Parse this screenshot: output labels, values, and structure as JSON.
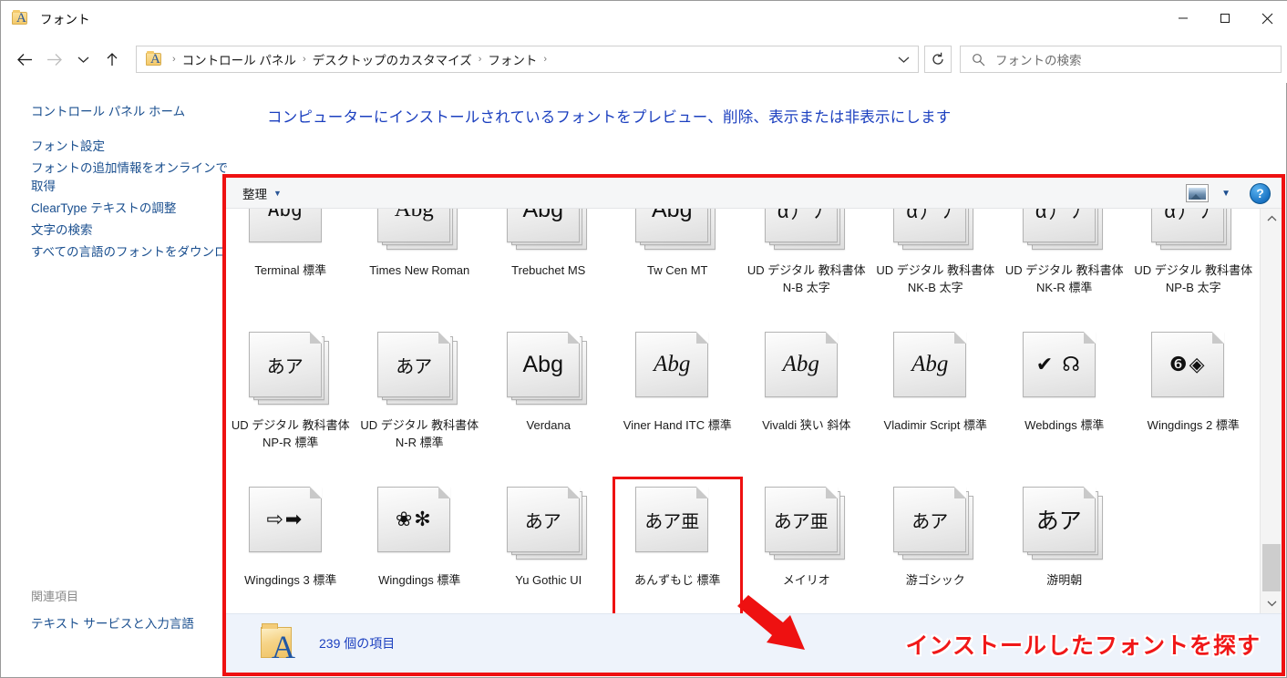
{
  "window": {
    "title": "フォント",
    "icon": "font-folder-icon",
    "minimize_label": "最小化",
    "maximize_label": "最大化",
    "close_label": "閉じる"
  },
  "addressbar": {
    "back_label": "戻る",
    "forward_label": "進む",
    "recent_label": "最近表示した場所",
    "up_label": "上へ",
    "refresh_label": "更新",
    "crumbs": [
      "コントロール パネル",
      "デスクトップのカスタマイズ",
      "フォント"
    ],
    "separator": "›",
    "dropdown_label": "▾"
  },
  "search": {
    "placeholder": "フォントの検索",
    "value": "",
    "icon": "search-icon"
  },
  "sidebar": {
    "items": [
      "コントロール パネル ホーム",
      "フォント設定",
      "フォントの追加情報をオンラインで取得",
      "ClearType テキストの調整",
      "文字の検索",
      "すべての言語のフォントをダウンロード"
    ],
    "related_title": "関連項目",
    "related_items": [
      "テキスト サービスと入力言語"
    ]
  },
  "main": {
    "heading": "コンピューターにインストールされているフォントをプレビュー、削除、表示または非表示にします"
  },
  "toolbar": {
    "organize_label": "整理",
    "organize_caret": "▼",
    "view_icon": "view-options-icon",
    "view_caret": "▼",
    "help_label": "?"
  },
  "grid": {
    "fonts": [
      {
        "name": "Terminal 標準",
        "glyph": "Abg",
        "style": "mono",
        "stack": false
      },
      {
        "name": "Times New Roman",
        "glyph": "Abg",
        "style": "serif",
        "stack": true
      },
      {
        "name": "Trebuchet MS",
        "glyph": "Abg",
        "style": "sans",
        "stack": true
      },
      {
        "name": "Tw Cen MT",
        "glyph": "Abg",
        "style": "sans",
        "stack": true
      },
      {
        "name": "UD デジタル 教科書体 N-B 太字",
        "glyph": "α）ﾌ",
        "style": "sym",
        "stack": true
      },
      {
        "name": "UD デジタル 教科書体 NK-B 太字",
        "glyph": "α）ﾌ",
        "style": "sym",
        "stack": true
      },
      {
        "name": "UD デジタル 教科書体 NK-R 標準",
        "glyph": "α）ﾌ",
        "style": "sym",
        "stack": true
      },
      {
        "name": "UD デジタル 教科書体 NP-B 太字",
        "glyph": "α）ﾌ",
        "style": "sym",
        "stack": true
      },
      {
        "name": "UD デジタル 教科書体 NP-R 標準",
        "glyph": "あア",
        "style": "small",
        "stack": true
      },
      {
        "name": "UD デジタル 教科書体 N-R 標準",
        "glyph": "あア",
        "style": "small",
        "stack": true
      },
      {
        "name": "Verdana",
        "glyph": "Abg",
        "style": "sans",
        "stack": true
      },
      {
        "name": "Viner Hand ITC 標準",
        "glyph": "Abg",
        "style": "ital",
        "stack": false
      },
      {
        "name": "Vivaldi 狭い 斜体",
        "glyph": "Abg",
        "style": "ital",
        "stack": false
      },
      {
        "name": "Vladimir Script 標準",
        "glyph": "Abg",
        "style": "ital",
        "stack": false
      },
      {
        "name": "Webdings 標準",
        "glyph": "✔ ☊",
        "style": "sym",
        "stack": false
      },
      {
        "name": "Wingdings 2 標準",
        "glyph": "❻◈",
        "style": "sym",
        "stack": false
      },
      {
        "name": "Wingdings 3 標準",
        "glyph": "⇨➡",
        "style": "sym",
        "stack": false
      },
      {
        "name": "Wingdings 標準",
        "glyph": "❀✻",
        "style": "sym",
        "stack": false
      },
      {
        "name": "Yu Gothic UI",
        "glyph": "あア",
        "style": "small",
        "stack": true
      },
      {
        "name": "あんずもじ 標準",
        "glyph": "あア亜",
        "style": "small",
        "stack": false,
        "selected": true
      },
      {
        "name": "メイリオ",
        "glyph": "あア亜",
        "style": "small",
        "stack": true
      },
      {
        "name": "游ゴシック",
        "glyph": "あア",
        "style": "small",
        "stack": true
      },
      {
        "name": "游明朝",
        "glyph": "あア",
        "style": "serif",
        "stack": true
      }
    ]
  },
  "scrollbar": {
    "up_label": "⌃",
    "down_label": "⌄"
  },
  "status": {
    "item_count_text": "239 個の項目",
    "icon": "font-folder-icon"
  },
  "annotation": {
    "callout_text": "インストールしたフォントを探す",
    "color": "#f01818",
    "arrow": "red-arrow-icon"
  }
}
